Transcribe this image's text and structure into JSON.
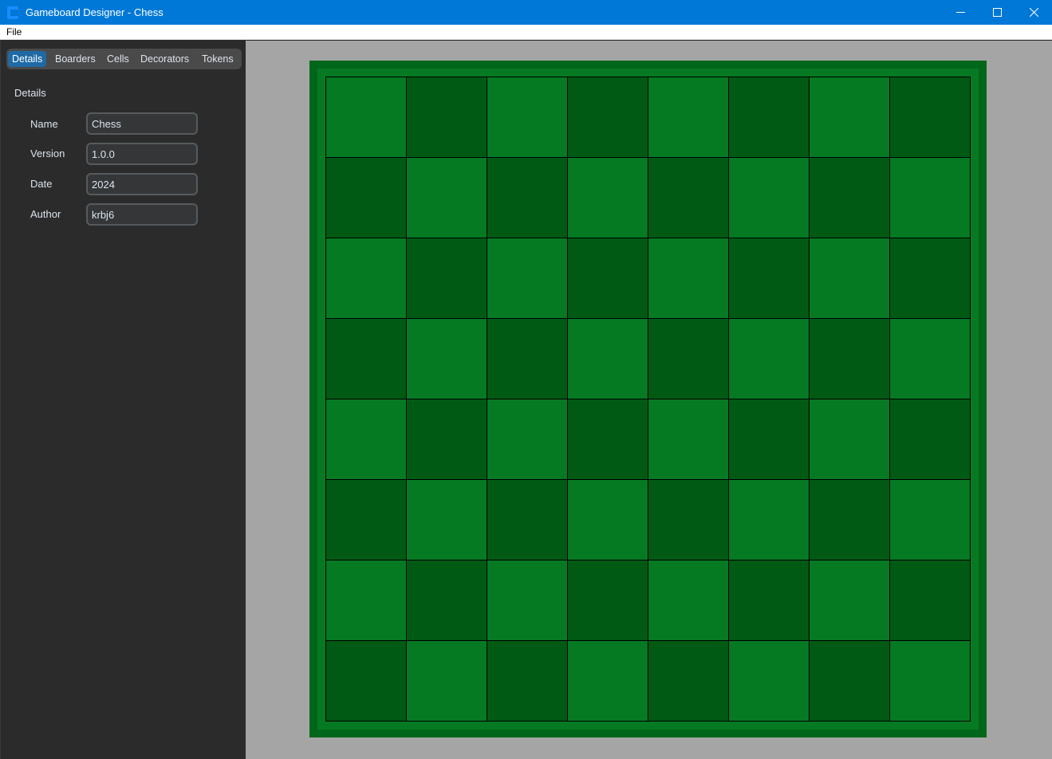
{
  "window": {
    "title": "Gameboard Designer - Chess",
    "minimize_icon": "minimize-icon",
    "maximize_icon": "maximize-icon",
    "close_icon": "close-icon"
  },
  "menu": {
    "file_label": "File"
  },
  "sidebar": {
    "tabs": [
      {
        "label": "Details",
        "active": true
      },
      {
        "label": "Boarders",
        "active": false
      },
      {
        "label": "Cells",
        "active": false
      },
      {
        "label": "Decorators",
        "active": false
      },
      {
        "label": "Tokens",
        "active": false
      }
    ],
    "section_title": "Details",
    "fields": [
      {
        "label": "Name",
        "value": "Chess"
      },
      {
        "label": "Version",
        "value": "1.0.0"
      },
      {
        "label": "Date",
        "value": "2024"
      },
      {
        "label": "Author",
        "value": "krbj6"
      }
    ]
  },
  "board": {
    "rows": 8,
    "cols": 8,
    "light_color": "#067a22",
    "dark_color": "#005a14",
    "border_outer_color": "#00661a",
    "border_inner_color": "#067a22",
    "grid_line_color": "#000000"
  },
  "colors": {
    "titlebar": "#0078d7",
    "sidebar_bg": "#2b2b2b",
    "tab_active": "#1f6aa5",
    "canvas_bg": "#a5a5a5"
  }
}
